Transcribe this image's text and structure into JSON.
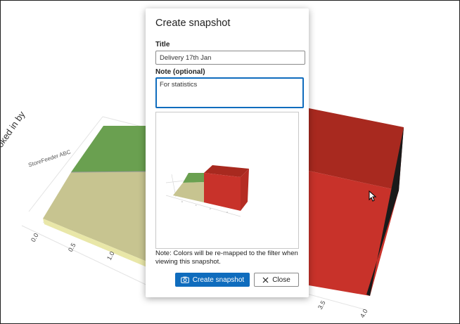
{
  "chart": {
    "y_axis_title": "Booked in by",
    "category_label": "StoreFeeder ABC",
    "left_ticks": [
      "0.0",
      "0.5",
      "1.0"
    ],
    "right_ticks": [
      "3.5",
      "4.0"
    ],
    "colors": {
      "green": "#6aa050",
      "khaki": "#c7c490",
      "red": "#c8322a",
      "dark_red": "#a8291f"
    }
  },
  "dialog": {
    "title": "Create snapshot",
    "title_label": "Title",
    "title_value": "Delivery 17th Jan",
    "note_label": "Note (optional)",
    "note_value": "For statistics",
    "remap_note": "Note: Colors will be re-mapped to the filter when viewing this snapshot.",
    "create_button": "Create snapshot",
    "close_button": "Close",
    "primary_color": "#0f6cbd"
  },
  "icons": {
    "create": "camera-icon",
    "close": "close-icon",
    "pointer": "mouse-cursor-icon"
  }
}
